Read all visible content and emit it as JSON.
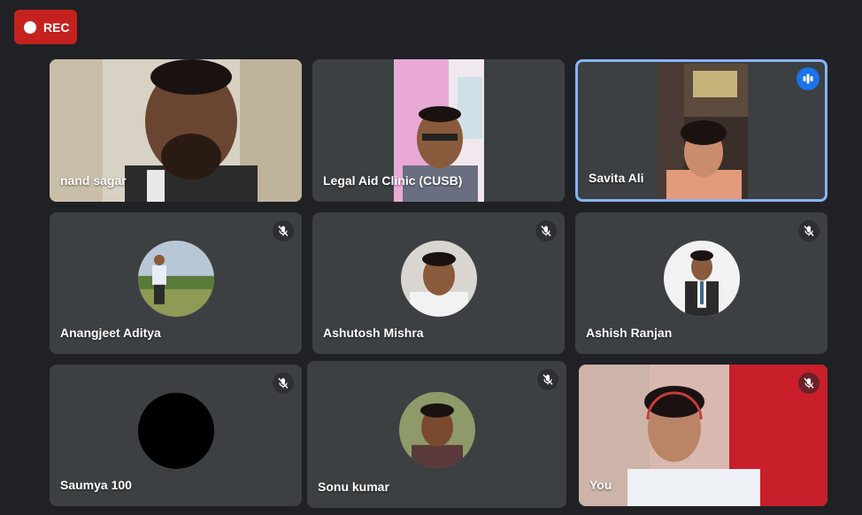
{
  "recording": {
    "label": "REC"
  },
  "participants": [
    {
      "name": "nand sagar"
    },
    {
      "name": "Legal Aid Clinic (CUSB)"
    },
    {
      "name": "Savita Ali"
    },
    {
      "name": "Anangjeet Aditya"
    },
    {
      "name": "Ashutosh Mishra"
    },
    {
      "name": "Ashish Ranjan"
    },
    {
      "name": "Saumya 100"
    },
    {
      "name": "Sonu kumar"
    },
    {
      "name": "You"
    }
  ],
  "icons": {
    "mic_off": "mic-off-icon",
    "speaking": "audio-level-icon",
    "rec": "record-dot-icon"
  },
  "colors": {
    "background": "#202124",
    "tile": "#3c4043",
    "rec": "#c5221f",
    "active_border": "#8ab4f8",
    "speaking": "#1a73e8"
  }
}
